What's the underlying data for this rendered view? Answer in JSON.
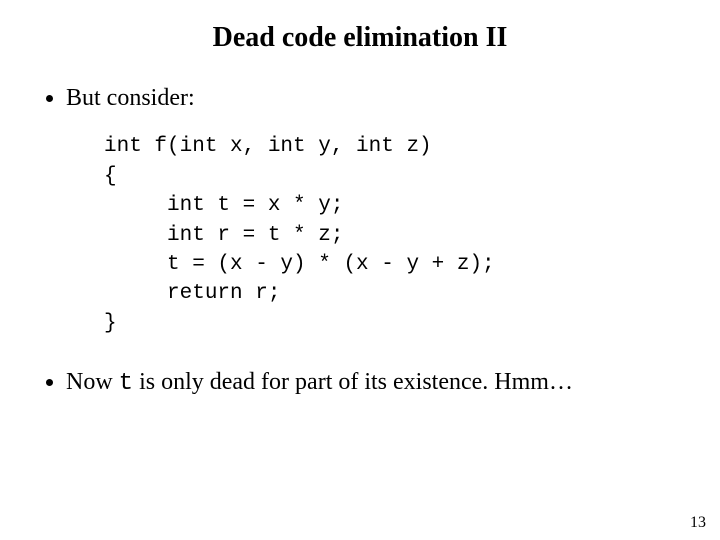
{
  "title": "Dead code elimination II",
  "bullets": {
    "first": "But consider:",
    "second_pre": "Now ",
    "second_mono": "t",
    "second_post": " is only dead for part of its existence.  Hmm…"
  },
  "code": "int f(int x, int y, int z)\n{\n     int t = x * y;\n     int r = t * z;\n     t = (x - y) * (x - y + z);\n     return r;\n}",
  "page_number": "13"
}
